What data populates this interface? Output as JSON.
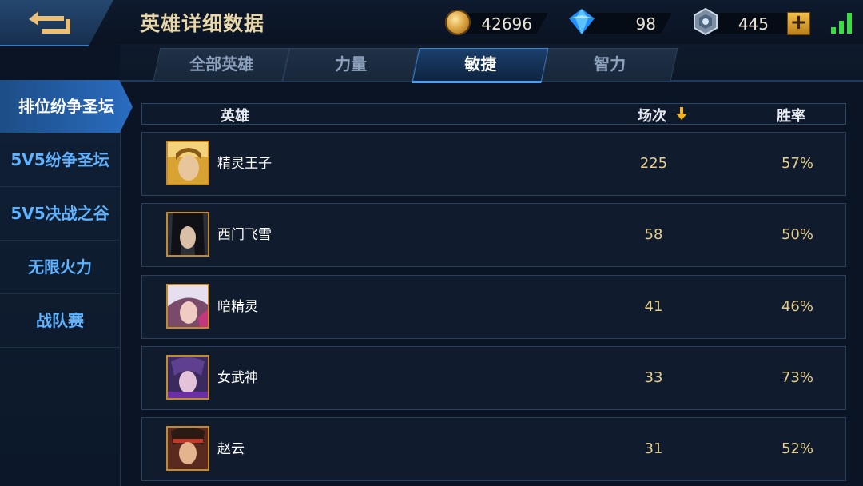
{
  "header": {
    "title": "英雄详细数据",
    "gold": "42696",
    "diamond": "98",
    "token": "445",
    "plus_label": "+"
  },
  "tabs": [
    "全部英雄",
    "力量",
    "敏捷",
    "智力"
  ],
  "active_tab": "敏捷",
  "sidebar": {
    "items": [
      "排位纷争圣坛",
      "5V5纷争圣坛",
      "5V5决战之谷",
      "无限火力",
      "战队赛"
    ],
    "active": "排位纷争圣坛"
  },
  "table": {
    "columns": {
      "hero": "英雄",
      "matches": "场次",
      "winrate": "胜率"
    },
    "sort_column": "场次",
    "rows": [
      {
        "hero": "精灵王子",
        "matches": "225",
        "winrate": "57%"
      },
      {
        "hero": "西门飞雪",
        "matches": "58",
        "winrate": "50%"
      },
      {
        "hero": "暗精灵",
        "matches": "41",
        "winrate": "46%"
      },
      {
        "hero": "女武神",
        "matches": "33",
        "winrate": "73%"
      },
      {
        "hero": "赵云",
        "matches": "31",
        "winrate": "52%"
      }
    ]
  },
  "icons": {
    "back": "back-arrow-icon",
    "gold": "gold-coin-icon",
    "diamond": "diamond-icon",
    "token": "token-icon",
    "signal": "signal-icon",
    "sort": "sort-down-icon"
  },
  "colors": {
    "accent_blue": "#46a4ff",
    "gold_text": "#e5cf8e",
    "sidebar_text": "#5fb3ff",
    "signal_green": "#3ddc46"
  }
}
